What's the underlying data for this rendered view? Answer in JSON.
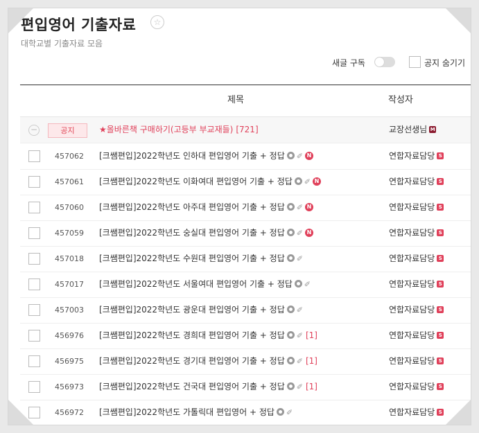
{
  "header": {
    "title": "편입영어 기출자료",
    "subtitle": "대학교별 기출자료 모음"
  },
  "options": {
    "subscribe_label": "새글 구독",
    "hide_notice_label": "공지 숨기기"
  },
  "table": {
    "columns": {
      "title": "제목",
      "writer": "작성자"
    },
    "notice": {
      "badge": "공지",
      "subject": "★올바른책 구매하기(고등부 부교재들)",
      "comments": "[721]",
      "writer": "교장선생님"
    },
    "rows": [
      {
        "num": "457062",
        "subject": "[크쌤편입]2022학년도 인하대 편입영어 기출 + 정답",
        "comments": "",
        "is_new": true,
        "writer": "연합자료담당"
      },
      {
        "num": "457061",
        "subject": "[크쌤편입]2022학년도 이화여대 편입영어 기출 + 정답",
        "comments": "",
        "is_new": true,
        "writer": "연합자료담당"
      },
      {
        "num": "457060",
        "subject": "[크쌤편입]2022학년도 아주대 편입영어 기출 + 정답",
        "comments": "",
        "is_new": true,
        "writer": "연합자료담당"
      },
      {
        "num": "457059",
        "subject": "[크쌤편입]2022학년도 숭실대 편입영어 기출 + 정답",
        "comments": "",
        "is_new": true,
        "writer": "연합자료담당"
      },
      {
        "num": "457018",
        "subject": "[크쌤편입]2022학년도 수원대 편입영어 기출 + 정답",
        "comments": "",
        "is_new": false,
        "writer": "연합자료담당"
      },
      {
        "num": "457017",
        "subject": "[크쌤편입]2022학년도 서울여대 편입영어 기출 + 정답",
        "comments": "",
        "is_new": false,
        "writer": "연합자료담당"
      },
      {
        "num": "457003",
        "subject": "[크쌤편입]2022학년도 광운대 편입영어 기출 + 정답",
        "comments": "",
        "is_new": false,
        "writer": "연합자료담당"
      },
      {
        "num": "456976",
        "subject": "[크쌤편입]2022학년도 경희대 편입영어 기출 + 정답",
        "comments": "[1]",
        "is_new": false,
        "writer": "연합자료담당"
      },
      {
        "num": "456975",
        "subject": "[크쌤편입]2022학년도 경기대 편입영어 기출 + 정답",
        "comments": "[1]",
        "is_new": false,
        "writer": "연합자료담당"
      },
      {
        "num": "456973",
        "subject": "[크쌤편입]2022학년도 건국대 편입영어 기출 + 정답",
        "comments": "[1]",
        "is_new": false,
        "writer": "연합자료담당"
      },
      {
        "num": "456972",
        "subject": "[크쌤편입]2022학년도 가톨릭대 편입영어 + 정답",
        "comments": "",
        "is_new": false,
        "writer": "연합자료담당"
      }
    ]
  },
  "icons": {
    "favorite": "star-icon",
    "collapse": "minus-circle-icon",
    "image": "image-icon",
    "attachment": "paperclip-icon",
    "new": "new-icon",
    "staff_badge": "staff-badge-icon",
    "manager_badge": "manager-badge-icon"
  },
  "colors": {
    "accent": "#e0405a",
    "notice_bg": "#fde8ea"
  }
}
